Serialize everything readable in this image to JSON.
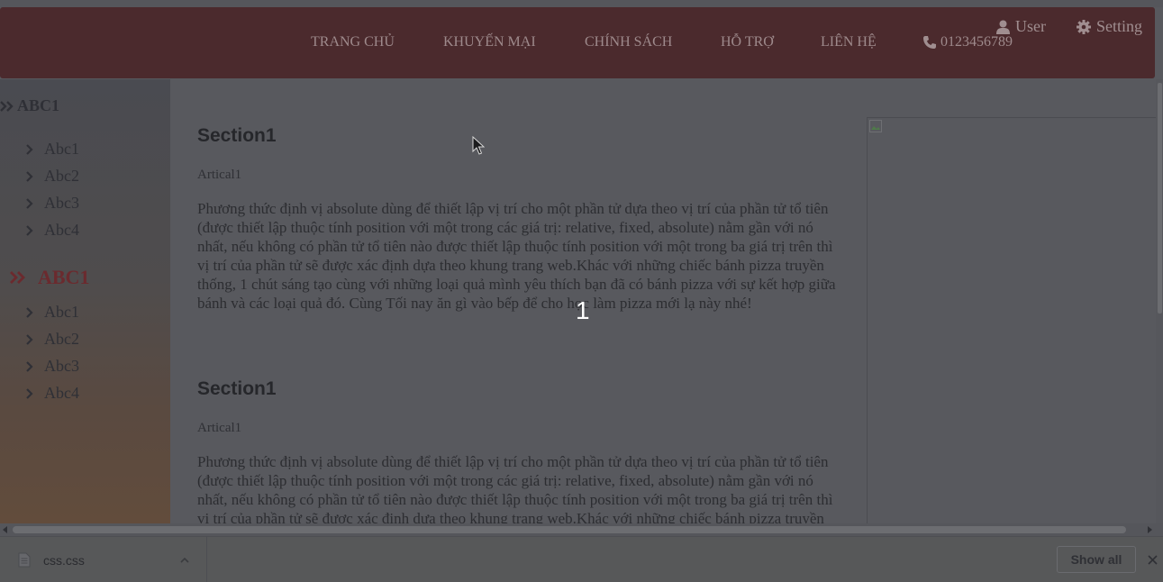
{
  "header": {
    "nav": [
      "TRANG CHỦ",
      "KHUYẾN MẠI",
      "CHÍNH SÁCH",
      "HỖ TRỢ",
      "LIÊN HỆ"
    ],
    "phone": "0123456789",
    "user_label": "User",
    "setting_label": "Setting"
  },
  "sidebar": {
    "group1": {
      "title": "ABC1",
      "items": [
        "Abc1",
        "Abc2",
        "Abc3",
        "Abc4"
      ]
    },
    "group2": {
      "title": "ABC1",
      "items": [
        "Abc1",
        "Abc2",
        "Abc3",
        "Abc4"
      ]
    }
  },
  "main": {
    "sections": [
      {
        "title": "Section1",
        "article": "Artical1",
        "text": "Phương thức định vị absolute dùng để thiết lập vị trí cho một phần tử dựa theo vị trí của phần tử tổ tiên (được thiết lập thuộc tính position với một trong các giá trị: relative, fixed, absolute) nằm gần với nó nhất, nếu không có phần tử tổ tiên nào được thiết lập thuộc tính position với một trong ba giá trị trên thì vị trí của phần tử sẽ được xác định dựa theo khung trang web.Khác với những chiếc bánh pizza truyền thống, 1 chút sáng tạo cùng với những loại quả mình yêu thích bạn đã có bánh pizza với sự kết hợp giữa bánh và các loại quả đó. Cùng Tối nay ăn gì vào bếp để cho học làm pizza mới lạ này nhé!"
      },
      {
        "title": "Section1",
        "article": "Artical1",
        "text": "Phương thức định vị absolute dùng để thiết lập vị trí cho một phần tử dựa theo vị trí của phần tử tổ tiên (được thiết lập thuộc tính position với một trong các giá trị: relative, fixed, absolute) nằm gần với nó nhất, nếu không có phần tử tổ tiên nào được thiết lập thuộc tính position với một trong ba giá trị trên thì vị trí của phần tử sẽ được xác định dựa theo khung trang web.Khác với những chiếc bánh pizza truyền thống, 1 chút sáng tạo cùng với những loại quả mình yêu thích bạn đã có bánh pizza với sự kết hợp giữa bánh và các loại quả đó. Cùng Tối nay ăn gì vào bếp để cho học làm pizza mới lạ này nhé!"
      }
    ]
  },
  "overlay": {
    "number": "1"
  },
  "downloads": {
    "file_name": "css.css",
    "show_all_label": "Show all"
  },
  "colors": {
    "header_bg": "#4b2a2d",
    "accent_red": "#6b2a2e"
  }
}
